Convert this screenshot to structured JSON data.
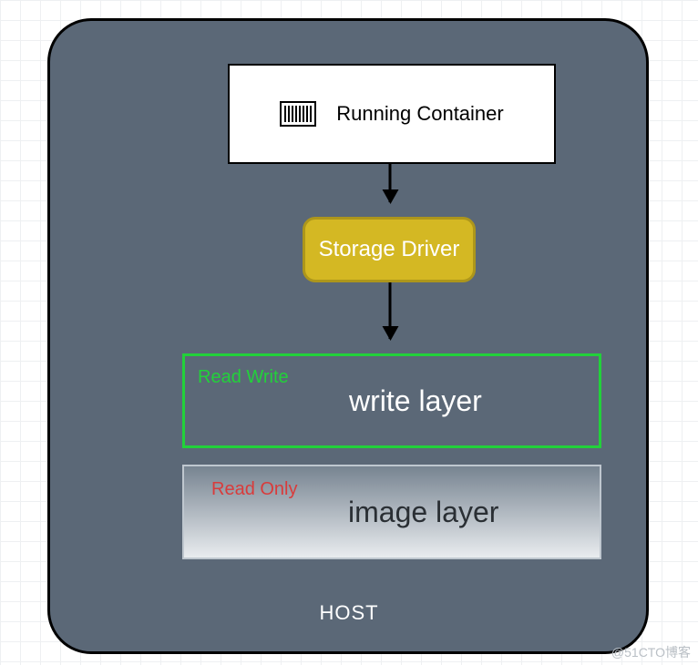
{
  "diagram": {
    "running_container": "Running Container",
    "storage_driver": "Storage Driver",
    "write_layer_tag": "Read Write",
    "write_layer_main": "write layer",
    "image_layer_tag": "Read Only",
    "image_layer_main": "image layer",
    "host_label": "HOST"
  },
  "watermark": "@51CTO博客"
}
